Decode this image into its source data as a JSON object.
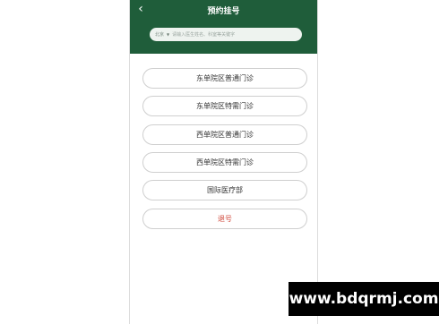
{
  "header": {
    "title": "预约挂号",
    "back_icon": "chevron-left-icon",
    "background": "#1f5d3a"
  },
  "search": {
    "city": "北京",
    "placeholder": "请输入医生姓名、科室等关键字"
  },
  "menu": {
    "items": [
      "东单院区普通门诊",
      "东单院区特需门诊",
      "西单院区普通门诊",
      "西单院区特需门诊",
      "国际医疗部",
      "退号"
    ],
    "cancel_color": "#d04a3c"
  },
  "watermark": {
    "text": "www.bdqrmj.com"
  }
}
